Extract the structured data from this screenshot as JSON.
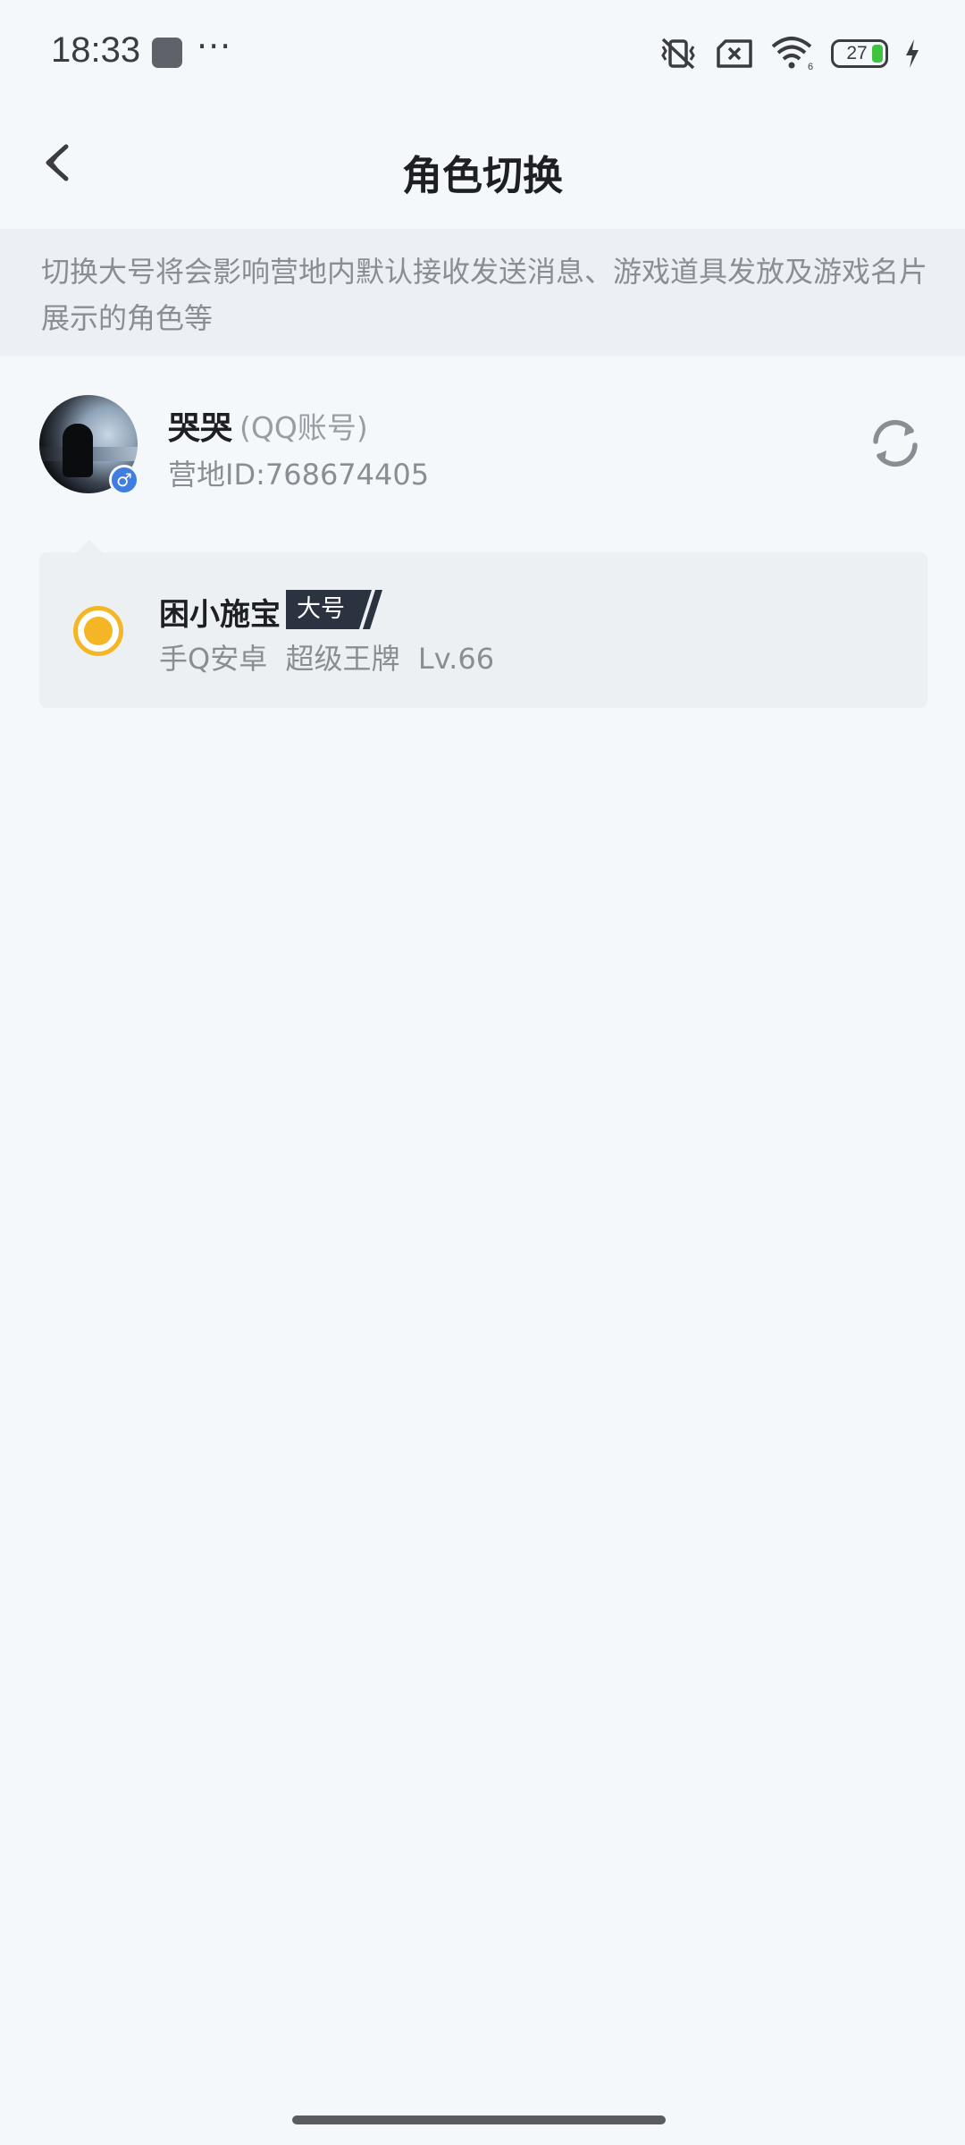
{
  "status_bar": {
    "time": "18:33",
    "dots": "···",
    "battery": "27",
    "icons": [
      "vibrate-off-icon",
      "sim-off-icon",
      "wifi-icon",
      "battery-icon",
      "charging-icon"
    ]
  },
  "header": {
    "title": "角色切换",
    "back_icon": "chevron-left-icon"
  },
  "notice": {
    "text": "切换大号将会影响营地内默认接收发送消息、游戏道具发放及游戏名片展示的角色等"
  },
  "account": {
    "name": "哭哭",
    "type": "(QQ账号)",
    "id": "营地ID:768674405",
    "gender_icon": "♂"
  },
  "role": {
    "name": "困小施宝",
    "badge": "大号",
    "info": "手Q安卓  超级王牌  Lv.66",
    "selected": true
  },
  "colors": {
    "background": "#f4f8fb",
    "accent": "#f5b625",
    "badge": "#2c3340",
    "gender": "#3f7de0"
  }
}
